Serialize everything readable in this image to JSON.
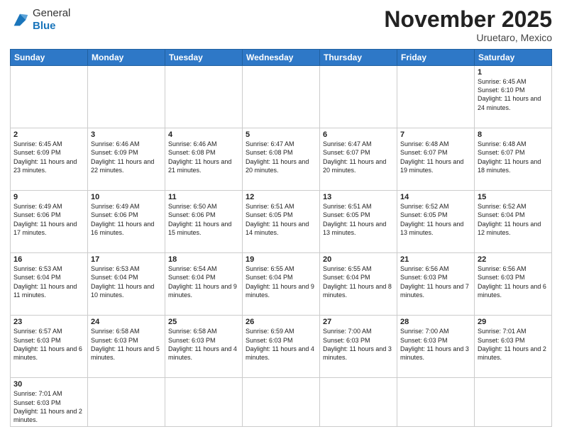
{
  "header": {
    "logo": {
      "general": "General",
      "blue": "Blue"
    },
    "title": "November 2025",
    "subtitle": "Uruetaro, Mexico"
  },
  "days": [
    "Sunday",
    "Monday",
    "Tuesday",
    "Wednesday",
    "Thursday",
    "Friday",
    "Saturday"
  ],
  "weeks": [
    [
      {
        "num": "",
        "info": "",
        "empty": true
      },
      {
        "num": "",
        "info": "",
        "empty": true
      },
      {
        "num": "",
        "info": "",
        "empty": true
      },
      {
        "num": "",
        "info": "",
        "empty": true
      },
      {
        "num": "",
        "info": "",
        "empty": true
      },
      {
        "num": "",
        "info": "",
        "empty": true
      },
      {
        "num": "1",
        "info": "Sunrise: 6:45 AM\nSunset: 6:10 PM\nDaylight: 11 hours\nand 24 minutes."
      }
    ],
    [
      {
        "num": "2",
        "info": "Sunrise: 6:45 AM\nSunset: 6:09 PM\nDaylight: 11 hours\nand 23 minutes."
      },
      {
        "num": "3",
        "info": "Sunrise: 6:46 AM\nSunset: 6:09 PM\nDaylight: 11 hours\nand 22 minutes."
      },
      {
        "num": "4",
        "info": "Sunrise: 6:46 AM\nSunset: 6:08 PM\nDaylight: 11 hours\nand 21 minutes."
      },
      {
        "num": "5",
        "info": "Sunrise: 6:47 AM\nSunset: 6:08 PM\nDaylight: 11 hours\nand 20 minutes."
      },
      {
        "num": "6",
        "info": "Sunrise: 6:47 AM\nSunset: 6:07 PM\nDaylight: 11 hours\nand 20 minutes."
      },
      {
        "num": "7",
        "info": "Sunrise: 6:48 AM\nSunset: 6:07 PM\nDaylight: 11 hours\nand 19 minutes."
      },
      {
        "num": "8",
        "info": "Sunrise: 6:48 AM\nSunset: 6:07 PM\nDaylight: 11 hours\nand 18 minutes."
      }
    ],
    [
      {
        "num": "9",
        "info": "Sunrise: 6:49 AM\nSunset: 6:06 PM\nDaylight: 11 hours\nand 17 minutes."
      },
      {
        "num": "10",
        "info": "Sunrise: 6:49 AM\nSunset: 6:06 PM\nDaylight: 11 hours\nand 16 minutes."
      },
      {
        "num": "11",
        "info": "Sunrise: 6:50 AM\nSunset: 6:06 PM\nDaylight: 11 hours\nand 15 minutes."
      },
      {
        "num": "12",
        "info": "Sunrise: 6:51 AM\nSunset: 6:05 PM\nDaylight: 11 hours\nand 14 minutes."
      },
      {
        "num": "13",
        "info": "Sunrise: 6:51 AM\nSunset: 6:05 PM\nDaylight: 11 hours\nand 13 minutes."
      },
      {
        "num": "14",
        "info": "Sunrise: 6:52 AM\nSunset: 6:05 PM\nDaylight: 11 hours\nand 13 minutes."
      },
      {
        "num": "15",
        "info": "Sunrise: 6:52 AM\nSunset: 6:04 PM\nDaylight: 11 hours\nand 12 minutes."
      }
    ],
    [
      {
        "num": "16",
        "info": "Sunrise: 6:53 AM\nSunset: 6:04 PM\nDaylight: 11 hours\nand 11 minutes."
      },
      {
        "num": "17",
        "info": "Sunrise: 6:53 AM\nSunset: 6:04 PM\nDaylight: 11 hours\nand 10 minutes."
      },
      {
        "num": "18",
        "info": "Sunrise: 6:54 AM\nSunset: 6:04 PM\nDaylight: 11 hours\nand 9 minutes."
      },
      {
        "num": "19",
        "info": "Sunrise: 6:55 AM\nSunset: 6:04 PM\nDaylight: 11 hours\nand 9 minutes."
      },
      {
        "num": "20",
        "info": "Sunrise: 6:55 AM\nSunset: 6:04 PM\nDaylight: 11 hours\nand 8 minutes."
      },
      {
        "num": "21",
        "info": "Sunrise: 6:56 AM\nSunset: 6:03 PM\nDaylight: 11 hours\nand 7 minutes."
      },
      {
        "num": "22",
        "info": "Sunrise: 6:56 AM\nSunset: 6:03 PM\nDaylight: 11 hours\nand 6 minutes."
      }
    ],
    [
      {
        "num": "23",
        "info": "Sunrise: 6:57 AM\nSunset: 6:03 PM\nDaylight: 11 hours\nand 6 minutes."
      },
      {
        "num": "24",
        "info": "Sunrise: 6:58 AM\nSunset: 6:03 PM\nDaylight: 11 hours\nand 5 minutes."
      },
      {
        "num": "25",
        "info": "Sunrise: 6:58 AM\nSunset: 6:03 PM\nDaylight: 11 hours\nand 4 minutes."
      },
      {
        "num": "26",
        "info": "Sunrise: 6:59 AM\nSunset: 6:03 PM\nDaylight: 11 hours\nand 4 minutes."
      },
      {
        "num": "27",
        "info": "Sunrise: 7:00 AM\nSunset: 6:03 PM\nDaylight: 11 hours\nand 3 minutes."
      },
      {
        "num": "28",
        "info": "Sunrise: 7:00 AM\nSunset: 6:03 PM\nDaylight: 11 hours\nand 3 minutes."
      },
      {
        "num": "29",
        "info": "Sunrise: 7:01 AM\nSunset: 6:03 PM\nDaylight: 11 hours\nand 2 minutes."
      }
    ],
    [
      {
        "num": "30",
        "info": "Sunrise: 7:01 AM\nSunset: 6:03 PM\nDaylight: 11 hours\nand 2 minutes."
      },
      {
        "num": "",
        "info": "",
        "empty": true
      },
      {
        "num": "",
        "info": "",
        "empty": true
      },
      {
        "num": "",
        "info": "",
        "empty": true
      },
      {
        "num": "",
        "info": "",
        "empty": true
      },
      {
        "num": "",
        "info": "",
        "empty": true
      },
      {
        "num": "",
        "info": "",
        "empty": true
      }
    ]
  ]
}
